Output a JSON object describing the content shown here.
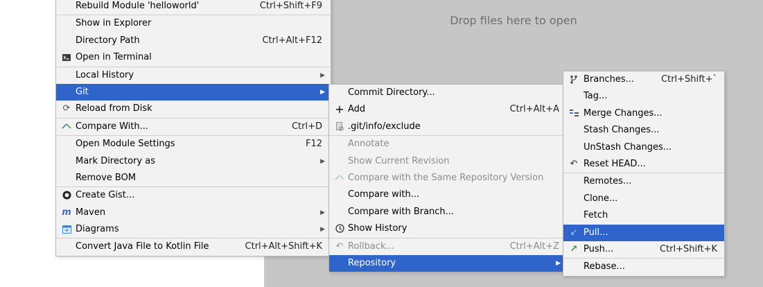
{
  "drop_hint": "Drop files here to open",
  "menu1": {
    "rebuild": {
      "label": "Rebuild Module 'helloworld'",
      "shortcut": "Ctrl+Shift+F9"
    },
    "show_explorer": {
      "label": "Show in Explorer"
    },
    "directory_path": {
      "label": "Directory Path",
      "shortcut": "Ctrl+Alt+F12"
    },
    "open_terminal": {
      "label": "Open in Terminal"
    },
    "local_history": {
      "label": "Local History"
    },
    "git": {
      "label": "Git"
    },
    "reload_disk": {
      "label": "Reload from Disk"
    },
    "compare_with": {
      "label": "Compare With...",
      "shortcut": "Ctrl+D"
    },
    "module_settings": {
      "label": "Open Module Settings",
      "shortcut": "F12"
    },
    "mark_directory": {
      "label": "Mark Directory as"
    },
    "remove_bom": {
      "label": "Remove BOM"
    },
    "create_gist": {
      "label": "Create Gist..."
    },
    "maven": {
      "label": "Maven"
    },
    "diagrams": {
      "label": "Diagrams"
    },
    "convert_kotlin": {
      "label": "Convert Java File to Kotlin File",
      "shortcut": "Ctrl+Alt+Shift+K"
    }
  },
  "menu2": {
    "commit_directory": {
      "label": "Commit Directory..."
    },
    "add": {
      "label": "Add",
      "shortcut": "Ctrl+Alt+A"
    },
    "gitinfo_exclude": {
      "label": ".git/info/exclude"
    },
    "annotate": {
      "label": "Annotate"
    },
    "show_current_revision": {
      "label": "Show Current Revision"
    },
    "compare_same_repo": {
      "label": "Compare with the Same Repository Version"
    },
    "compare_with": {
      "label": "Compare with..."
    },
    "compare_branch": {
      "label": "Compare with Branch..."
    },
    "show_history": {
      "label": "Show History"
    },
    "rollback": {
      "label": "Rollback...",
      "shortcut": "Ctrl+Alt+Z"
    },
    "repository": {
      "label": "Repository"
    }
  },
  "menu3": {
    "branches": {
      "label": "Branches...",
      "shortcut": "Ctrl+Shift+`"
    },
    "tag": {
      "label": "Tag..."
    },
    "merge_changes": {
      "label": "Merge Changes..."
    },
    "stash_changes": {
      "label": "Stash Changes..."
    },
    "unstash_changes": {
      "label": "UnStash Changes..."
    },
    "reset_head": {
      "label": "Reset HEAD..."
    },
    "remotes": {
      "label": "Remotes..."
    },
    "clone": {
      "label": "Clone..."
    },
    "fetch": {
      "label": "Fetch"
    },
    "pull": {
      "label": "Pull..."
    },
    "push": {
      "label": "Push...",
      "shortcut": "Ctrl+Shift+K"
    },
    "rebase": {
      "label": "Rebase..."
    }
  },
  "colors": {
    "selection": "#2f65ca",
    "menu_bg": "#f2f2f2",
    "editor_bg": "#c6c6c6"
  }
}
